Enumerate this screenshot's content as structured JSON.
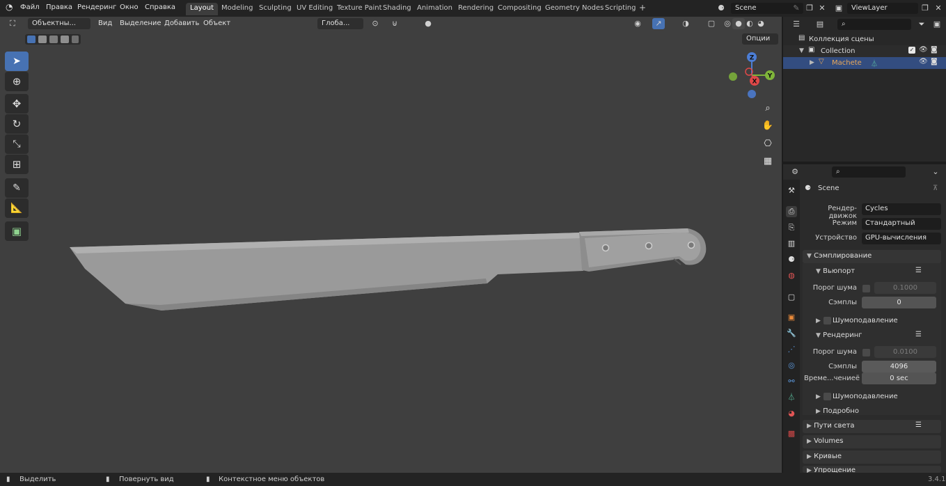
{
  "app": {
    "menus": [
      "Файл",
      "Правка",
      "Рендеринг",
      "Окно",
      "Справка"
    ],
    "workspaces": [
      "Layout",
      "Modeling",
      "Sculpting",
      "UV Editing",
      "Texture Paint",
      "Shading",
      "Animation",
      "Rendering",
      "Compositing",
      "Geometry Nodes",
      "Scripting"
    ],
    "active_workspace": "Layout",
    "scene": "Scene",
    "view_layer": "ViewLayer",
    "add_tab": "+"
  },
  "viewport": {
    "mode": "Объектны...",
    "menus": [
      "Вид",
      "Выделение",
      "Добавить",
      "Объект"
    ],
    "orientation": "Глоба...",
    "options": "Опции",
    "gizmo_axes": [
      "Z",
      "Y",
      "X"
    ],
    "object_color": "#9a9a9a",
    "background_color": "#3f3f3f"
  },
  "outliner": {
    "scene_collection": "Коллекция сцены",
    "collection": "Collection",
    "object": "Machete",
    "object_color": "#e9a85a"
  },
  "properties": {
    "scene_label": "Scene",
    "engine_label": "Рендер-движок",
    "engine_value": "Cycles",
    "mode_label": "Режим",
    "mode_value": "Стандартный",
    "device_label": "Устройство",
    "device_value": "GPU-вычисления",
    "sampling": "Сэмплирование",
    "viewport_sub": "Вьюпорт",
    "noise_threshold_label": "Порог шума",
    "viewport_noise": "0.1000",
    "samples_label": "Сэмплы",
    "viewport_samples": "0",
    "denoise": "Шумоподавление",
    "render_sub": "Рендеринг",
    "render_noise": "0.0100",
    "render_samples": "4096",
    "time_limit_label": "Време...чениеё",
    "time_limit": "0 sec",
    "advanced": "Подробно",
    "light_paths": "Пути света",
    "volumes": "Volumes",
    "curves": "Кривые",
    "simplify": "Упрощение"
  },
  "status": {
    "select": "Выделить",
    "rotate": "Повернуть вид",
    "context": "Контекстное меню объектов",
    "version": "3.4.1"
  }
}
